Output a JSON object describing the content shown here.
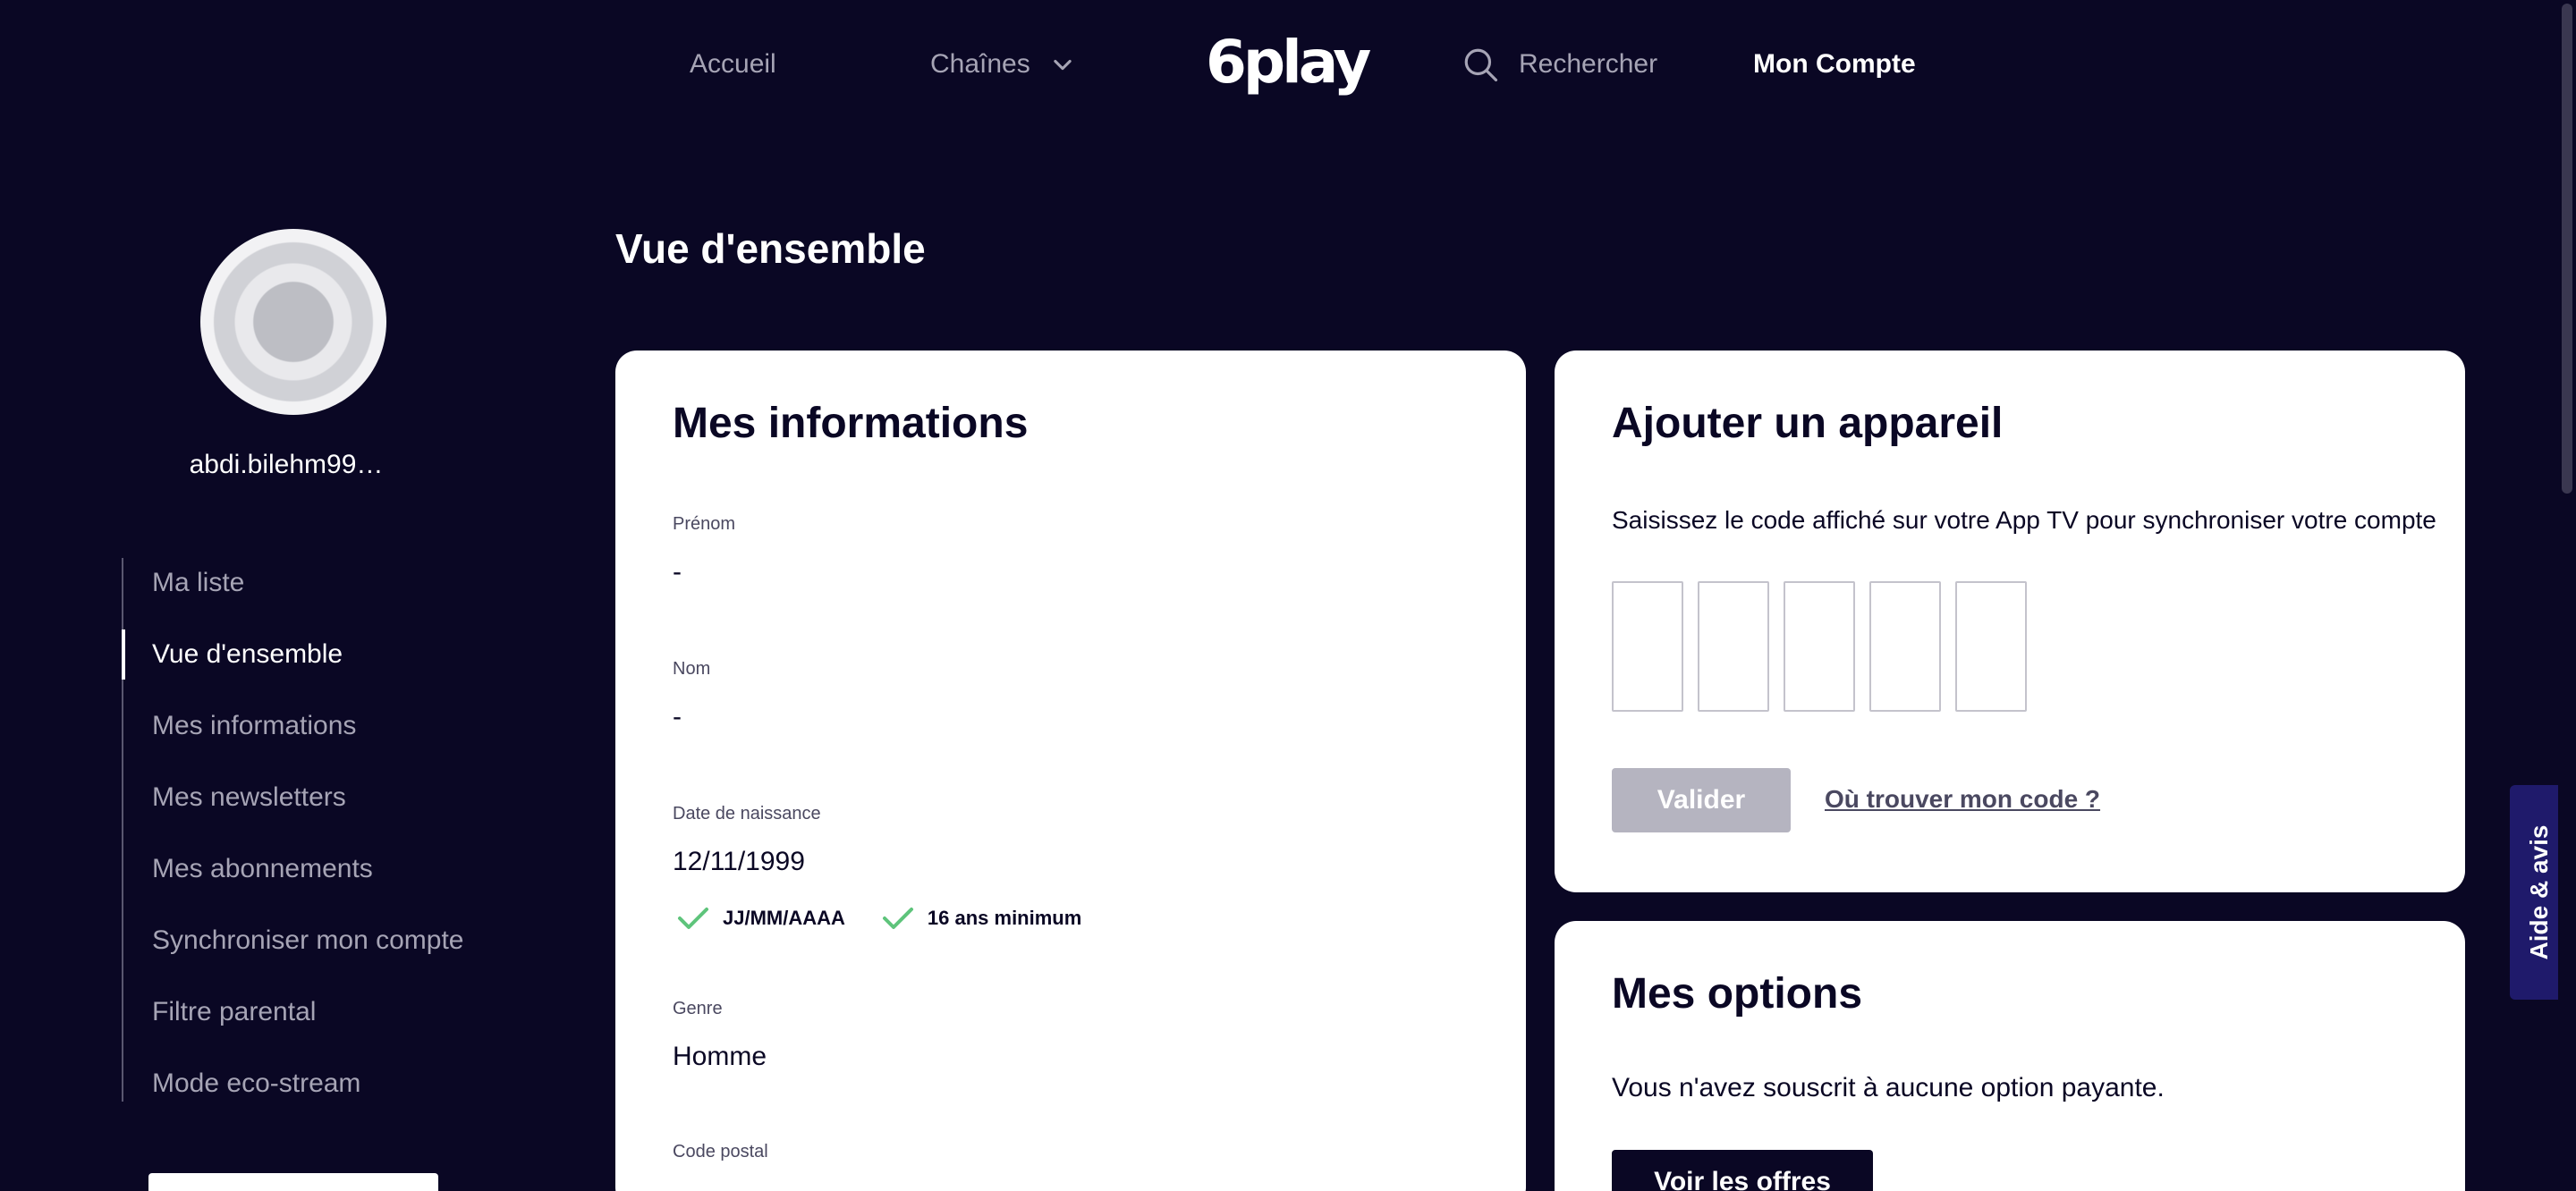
{
  "header": {
    "nav_home": "Accueil",
    "nav_channels": "Chaînes",
    "logo_text": "6play",
    "search_label": "Rechercher",
    "nav_account": "Mon Compte"
  },
  "sidebar": {
    "username": "abdi.bilehm99…",
    "items": [
      {
        "label": "Ma liste",
        "active": false
      },
      {
        "label": "Vue d'ensemble",
        "active": true
      },
      {
        "label": "Mes informations",
        "active": false
      },
      {
        "label": "Mes newsletters",
        "active": false
      },
      {
        "label": "Mes abonnements",
        "active": false
      },
      {
        "label": "Synchroniser mon compte",
        "active": false
      },
      {
        "label": "Filtre parental",
        "active": false
      },
      {
        "label": "Mode eco-stream",
        "active": false
      }
    ]
  },
  "main": {
    "title": "Vue d'ensemble",
    "info_card": {
      "title": "Mes informations",
      "fields": [
        {
          "label": "Prénom",
          "value": "-"
        },
        {
          "label": "Nom",
          "value": "-"
        },
        {
          "label": "Date de naissance",
          "value": "12/11/1999"
        },
        {
          "label": "Genre",
          "value": "Homme"
        },
        {
          "label": "Code postal",
          "value": ""
        }
      ],
      "validations": [
        "JJ/MM/AAAA",
        "16 ans minimum"
      ]
    },
    "device_card": {
      "title": "Ajouter un appareil",
      "description": "Saisissez le code affiché sur votre App TV pour synchroniser votre compte",
      "validate_label": "Valider",
      "help_link": "Où trouver mon code ?"
    },
    "options_card": {
      "title": "Mes options",
      "text": "Vous n'avez souscrit à aucune option payante.",
      "button_label": "Voir les offres"
    }
  },
  "help_tab": {
    "label": "Aide & avis"
  },
  "colors": {
    "background": "#0a0724",
    "card": "#ffffff",
    "muted_text": "#a6a4b5",
    "check_green": "#5ec47b",
    "disabled_button": "#b5b4c0",
    "help_tab": "#1f1a6b"
  }
}
